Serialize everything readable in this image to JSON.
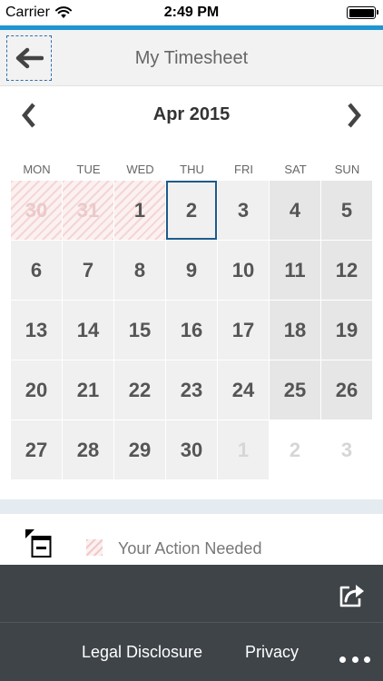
{
  "status_bar": {
    "carrier": "Carrier",
    "time": "2:49 PM",
    "battery_level": 1.0
  },
  "header": {
    "title": "My Timesheet",
    "back_icon": "arrow-left-icon"
  },
  "calendar": {
    "month_label": "Apr 2015",
    "prev_icon": "chevron-left-icon",
    "next_icon": "chevron-right-icon",
    "weekdays": [
      "MON",
      "TUE",
      "WED",
      "THU",
      "FRI",
      "SAT",
      "SUN"
    ],
    "days": [
      {
        "label": "30",
        "outside_month": true,
        "weekend": false,
        "action_needed": true,
        "today": false
      },
      {
        "label": "31",
        "outside_month": true,
        "weekend": false,
        "action_needed": true,
        "today": false
      },
      {
        "label": "1",
        "outside_month": false,
        "weekend": false,
        "action_needed": true,
        "today": false
      },
      {
        "label": "2",
        "outside_month": false,
        "weekend": false,
        "action_needed": false,
        "today": true
      },
      {
        "label": "3",
        "outside_month": false,
        "weekend": false,
        "action_needed": false,
        "today": false
      },
      {
        "label": "4",
        "outside_month": false,
        "weekend": true,
        "action_needed": false,
        "today": false
      },
      {
        "label": "5",
        "outside_month": false,
        "weekend": true,
        "action_needed": false,
        "today": false
      },
      {
        "label": "6",
        "outside_month": false,
        "weekend": false,
        "action_needed": false,
        "today": false
      },
      {
        "label": "7",
        "outside_month": false,
        "weekend": false,
        "action_needed": false,
        "today": false
      },
      {
        "label": "8",
        "outside_month": false,
        "weekend": false,
        "action_needed": false,
        "today": false
      },
      {
        "label": "9",
        "outside_month": false,
        "weekend": false,
        "action_needed": false,
        "today": false
      },
      {
        "label": "10",
        "outside_month": false,
        "weekend": false,
        "action_needed": false,
        "today": false
      },
      {
        "label": "11",
        "outside_month": false,
        "weekend": true,
        "action_needed": false,
        "today": false
      },
      {
        "label": "12",
        "outside_month": false,
        "weekend": true,
        "action_needed": false,
        "today": false
      },
      {
        "label": "13",
        "outside_month": false,
        "weekend": false,
        "action_needed": false,
        "today": false
      },
      {
        "label": "14",
        "outside_month": false,
        "weekend": false,
        "action_needed": false,
        "today": false
      },
      {
        "label": "15",
        "outside_month": false,
        "weekend": false,
        "action_needed": false,
        "today": false
      },
      {
        "label": "16",
        "outside_month": false,
        "weekend": false,
        "action_needed": false,
        "today": false
      },
      {
        "label": "17",
        "outside_month": false,
        "weekend": false,
        "action_needed": false,
        "today": false
      },
      {
        "label": "18",
        "outside_month": false,
        "weekend": true,
        "action_needed": false,
        "today": false
      },
      {
        "label": "19",
        "outside_month": false,
        "weekend": true,
        "action_needed": false,
        "today": false
      },
      {
        "label": "20",
        "outside_month": false,
        "weekend": false,
        "action_needed": false,
        "today": false
      },
      {
        "label": "21",
        "outside_month": false,
        "weekend": false,
        "action_needed": false,
        "today": false
      },
      {
        "label": "22",
        "outside_month": false,
        "weekend": false,
        "action_needed": false,
        "today": false
      },
      {
        "label": "23",
        "outside_month": false,
        "weekend": false,
        "action_needed": false,
        "today": false
      },
      {
        "label": "24",
        "outside_month": false,
        "weekend": false,
        "action_needed": false,
        "today": false
      },
      {
        "label": "25",
        "outside_month": false,
        "weekend": true,
        "action_needed": false,
        "today": false
      },
      {
        "label": "26",
        "outside_month": false,
        "weekend": true,
        "action_needed": false,
        "today": false
      },
      {
        "label": "27",
        "outside_month": false,
        "weekend": false,
        "action_needed": false,
        "today": false
      },
      {
        "label": "28",
        "outside_month": false,
        "weekend": false,
        "action_needed": false,
        "today": false
      },
      {
        "label": "29",
        "outside_month": false,
        "weekend": false,
        "action_needed": false,
        "today": false
      },
      {
        "label": "30",
        "outside_month": false,
        "weekend": false,
        "action_needed": false,
        "today": false
      },
      {
        "label": "1",
        "outside_month": true,
        "weekend": false,
        "action_needed": false,
        "today": false,
        "boxed": true
      },
      {
        "label": "2",
        "outside_month": true,
        "weekend": true,
        "action_needed": false,
        "today": false
      },
      {
        "label": "3",
        "outside_month": true,
        "weekend": true,
        "action_needed": false,
        "today": false
      }
    ]
  },
  "legend": {
    "toggle_icon": "collapse-legend-icon",
    "action_needed_label": "Your Action Needed"
  },
  "footer": {
    "share_icon": "share-icon",
    "legal_label": "Legal Disclosure",
    "privacy_label": "Privacy",
    "more_icon": "more-icon"
  },
  "colors": {
    "accent": "#1f95d3",
    "today_border": "#1d5a8c",
    "footer_bg": "#3f4448",
    "action_hatch": "#e8a0a0"
  }
}
